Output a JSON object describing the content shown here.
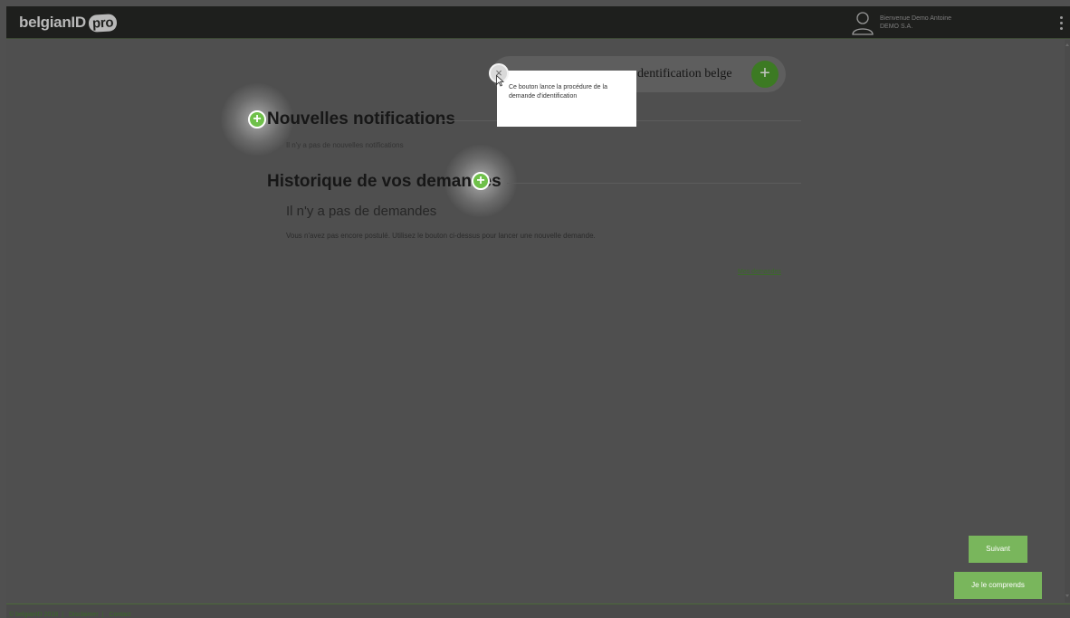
{
  "header": {
    "logo_text": "belgianID",
    "logo_badge": "pro",
    "user_greeting": "Bienvenue Demo Antoine",
    "user_company": "DEMO S.A."
  },
  "main": {
    "new_request_label": "dentification belge",
    "notifications_title": "Nouvelles notifications",
    "notifications_empty": "Il n'y a pas de nouvelles notifications",
    "history_title": "Historique de vos demandes",
    "no_requests_title": "Il n'y a pas de demandes",
    "no_requests_desc": "Vous n'avez pas encore postulé. Utilisez le bouton ci-dessus pour lancer une nouvelle demande.",
    "my_requests_link": "Mes demandes"
  },
  "tooltip": {
    "text": "Ce bouton lance la procédure de la demande d'identification",
    "close_glyph": "×"
  },
  "tour": {
    "next_label": "Suivant",
    "understand_label": "Je le comprends"
  },
  "footer": {
    "links": [
      "© belgianID 2018",
      "Disclaimer",
      "Contact"
    ]
  },
  "icons": {
    "plus": "+",
    "kebab": "more-vertical-icon",
    "user": "user-icon"
  },
  "colors": {
    "accent_green": "#79b65c",
    "dark_green": "#3c7a23",
    "overlay": "#505050",
    "topbar": "#1e1f1d"
  }
}
